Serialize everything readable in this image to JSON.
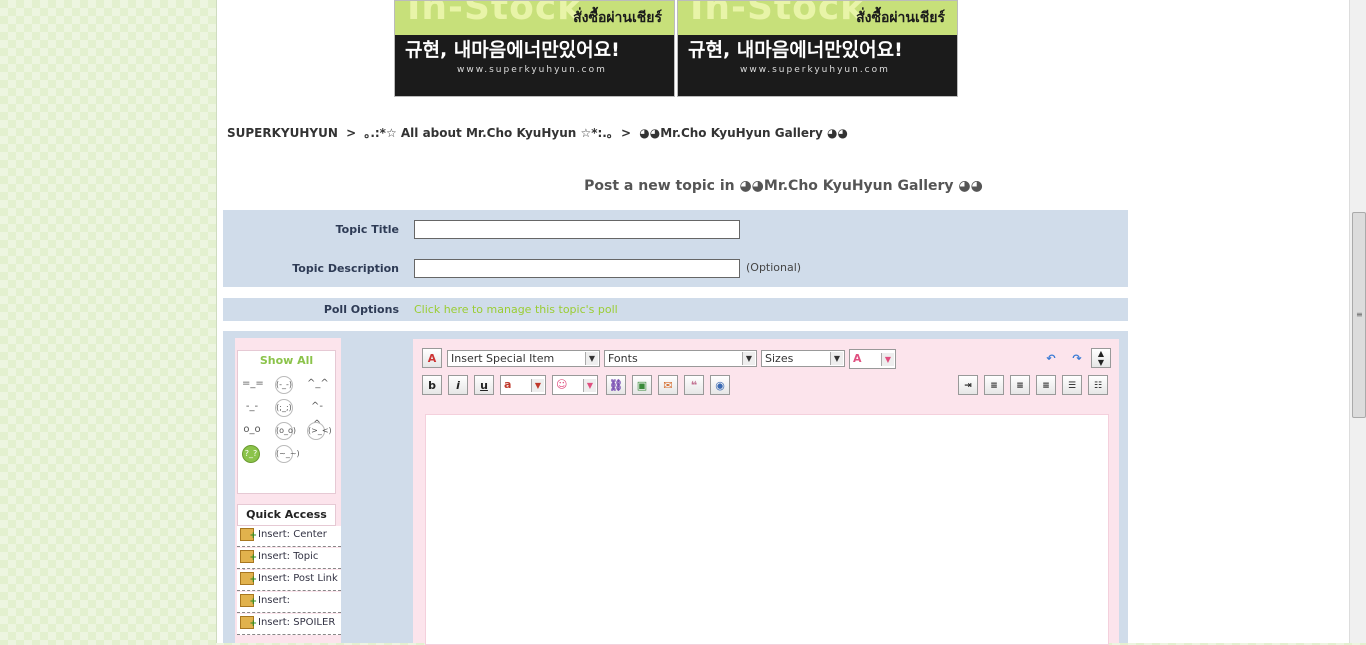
{
  "banners": [
    {
      "heading": "In-Stock",
      "thai": "สั่งซื้อผ่านเชียร์",
      "korean": "규현, 내마음에너만있어요!",
      "url": "www.superkyuhyun.com"
    },
    {
      "heading": "In-Stock",
      "thai": "สั่งซื้อผ่านเชียร์",
      "korean": "규현, 내마음에너만있어요!",
      "url": "www.superkyuhyun.com"
    }
  ],
  "breadcrumb": {
    "home": "SUPERKYUHYUN",
    "sep": ">",
    "category": "｡.:*☆ All about Mr.Cho KyuHyun ☆*:.｡",
    "forum": "◕◕Mr.Cho KyuHyun Gallery ◕◕"
  },
  "page_title": "Post a new topic in ◕◕Mr.Cho KyuHyun Gallery ◕◕",
  "form": {
    "topic_title_label": "Topic Title",
    "topic_title_value": "",
    "topic_desc_label": "Topic Description",
    "topic_desc_value": "",
    "optional_text": "(Optional)"
  },
  "poll": {
    "label": "Poll Options",
    "link": "Click here to manage this topic's poll"
  },
  "emoticons": {
    "show_all": "Show All",
    "items": [
      "=_=",
      "(-_-)",
      "^_^",
      "-_-",
      "(;_;)",
      "^-^",
      "o_o",
      "(o_o)",
      "(>_<)",
      "?_?",
      "(~_~)"
    ]
  },
  "quick_access": {
    "title": "Quick Access",
    "items": [
      "Insert: Center",
      "Insert: Topic Link",
      "Insert: Post Link",
      "Insert: CODEBOX",
      "Insert: SPOILER"
    ]
  },
  "toolbar": {
    "special_item": "Insert Special Item",
    "fonts": "Fonts",
    "sizes": "Sizes",
    "bold": "b",
    "italic": "i",
    "underline": "u"
  },
  "colors": {
    "poll_link": "#9acd32",
    "form_bg": "#d0dcea",
    "editor_bg": "#fce4ec"
  }
}
